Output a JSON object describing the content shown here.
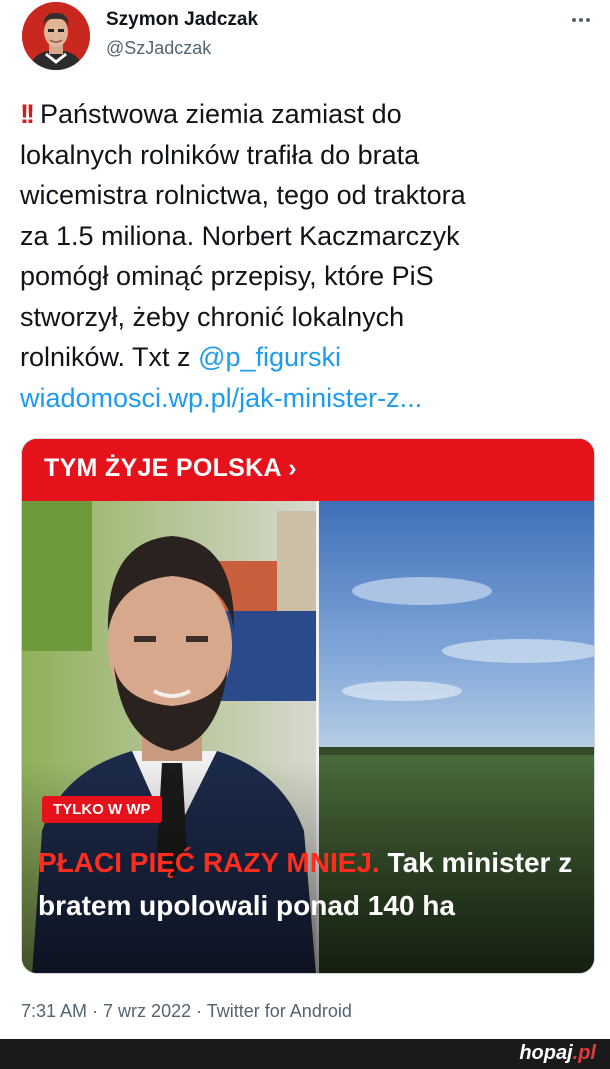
{
  "author": {
    "name": "Szymon Jadczak",
    "handle": "@SzJadczak"
  },
  "tweet": {
    "icon": "double-exclamation-icon",
    "lines": [
      "Państwowa ziemia zamiast do",
      "lokalnych rolników trafiła do brata",
      "wicemistra rolnictwa, tego od traktora",
      "za 1.5 miliona. Norbert Kaczmarczyk",
      "pomógł ominąć przepisy, które PiS",
      "stworzył, żeby chronić lokalnych"
    ],
    "last_line_prefix": "rolników. Txt z ",
    "mention": "@p_figurski",
    "url": "wiadomosci.wp.pl/jak-minister-z..."
  },
  "card": {
    "section_label": "TYM ŻYJE POLSKA",
    "section_chevron": "›",
    "badge": "TYLKO W WP",
    "headline_red": "PŁACI PIĘĆ RAZY MNIEJ.",
    "headline_rest": " Tak minister z bratem upolowali ponad 140 ha"
  },
  "meta": {
    "time": "7:31 AM",
    "date": "7 wrz 2022",
    "source": "Twitter for Android",
    "separator": " · "
  },
  "watermark": {
    "text": "hopaj",
    "dot": ".pl"
  },
  "colors": {
    "brand_red": "#e5111b",
    "link_blue": "#1d9bf0",
    "muted": "#536471"
  }
}
